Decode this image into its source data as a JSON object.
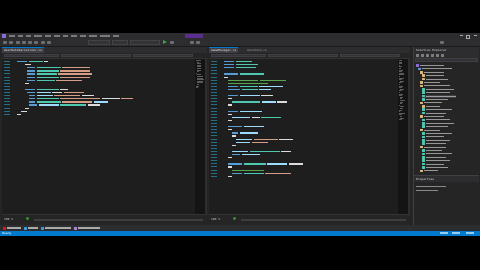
{
  "window": {
    "title_tag": "",
    "menu_widths": [
      6,
      5,
      5,
      8,
      6,
      6,
      5,
      6,
      6,
      8,
      10,
      6
    ]
  },
  "toolbar": {
    "buttons": 14
  },
  "left_editor": {
    "tab": {
      "label": "UserDataSerializer.cs"
    },
    "zoom": "100 %"
  },
  "right_editor": {
    "tabs": [
      {
        "label": "GameManager.cs"
      },
      {
        "label": "UserData.cs"
      }
    ],
    "zoom": "100 %"
  },
  "solution_explorer": {
    "title": "Solution Explorer",
    "properties_title": "Properties"
  },
  "bottom_tabs": [
    "Error List",
    "Output",
    "Package Manager Console",
    "Find Symbol Results"
  ],
  "statusbar": {
    "ready": "Ready"
  },
  "colors": {
    "editor_bg": "#1e1e1e",
    "chrome_bg": "#2d2d30",
    "statusbar": "#007acc",
    "keyword": "#569cd6",
    "type": "#4ec9b0",
    "string": "#d69d85",
    "comment": "#57a64a",
    "identifier": "#9cdcfe",
    "text": "#dcdcdc"
  }
}
